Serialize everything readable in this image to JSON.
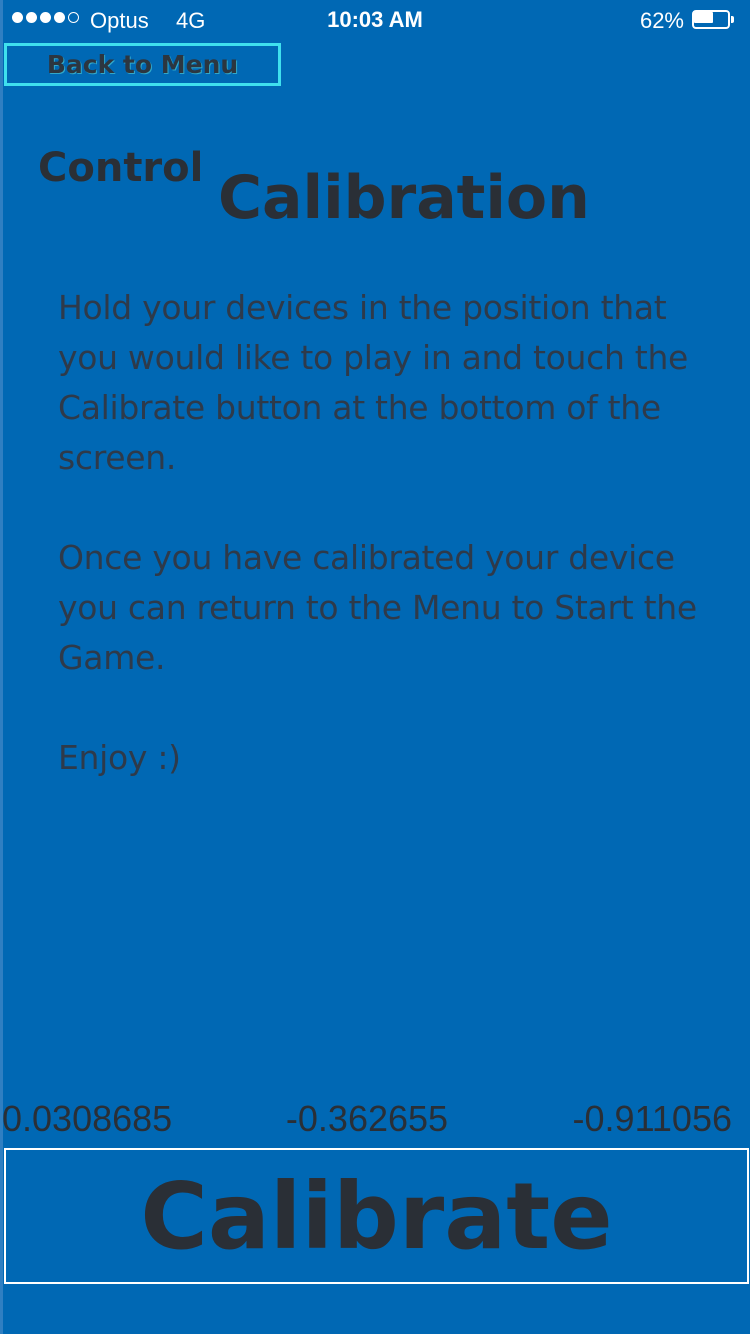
{
  "status_bar": {
    "signal_strength_bars": 4,
    "signal_max_bars": 5,
    "carrier": "Optus",
    "network": "4G",
    "time": "10:03 AM",
    "battery_percent": "62%",
    "battery_level": 0.62
  },
  "header": {
    "back_button_label": "Back to Menu"
  },
  "title": {
    "part1": "Control",
    "part2": "Calibration"
  },
  "instructions": {
    "paragraph1": "Hold your devices in the position that you would like to play in and touch the Calibrate button at the bottom of the screen.",
    "paragraph2": "Once you have calibrated your device you can return to the Menu to Start the Game.",
    "paragraph3": "Enjoy :)"
  },
  "readings": {
    "x": "0.0308685",
    "y": "-0.362655",
    "z": "-0.911056"
  },
  "footer": {
    "calibrate_label": "Calibrate"
  },
  "colors": {
    "background": "#0068b4",
    "text": "#2a2f36",
    "back_button_border": "#3fe0ee",
    "calibrate_border": "#ffffff"
  }
}
